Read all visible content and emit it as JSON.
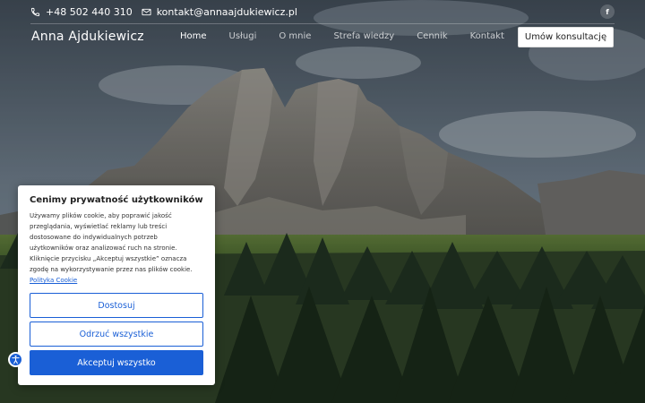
{
  "topbar": {
    "phone": "+48 502 440 310",
    "email": "kontakt@annaajdukiewicz.pl",
    "social_label": "f"
  },
  "header": {
    "brand": "Anna Ajdukiewicz",
    "nav": [
      "Home",
      "Usługi",
      "O mnie",
      "Strefa wiedzy",
      "Cennik",
      "Kontakt"
    ],
    "active_nav": "Home",
    "cta": "Umów konsultację"
  },
  "cookie": {
    "title": "Cenimy prywatność użytkowników",
    "body": "Używamy plików cookie, aby poprawić jakość przeglądania, wyświetlać reklamy lub treści dostosowane do indywidualnych potrzeb użytkowników oraz analizować ruch na stronie. Kliknięcie przycisku „Akceptuj wszystkie” oznacza zgodę na wykorzystywanie przez nas plików cookie.",
    "link": "Polityka Cookie",
    "customize": "Dostosuj",
    "reject": "Odrzuć wszystkie",
    "accept": "Akceptuj wszystko"
  },
  "colors": {
    "accent": "#1a5fd6",
    "button_bg": "#ffffff"
  },
  "icons": [
    "phone-icon",
    "envelope-icon",
    "facebook-icon",
    "accessibility-icon"
  ]
}
